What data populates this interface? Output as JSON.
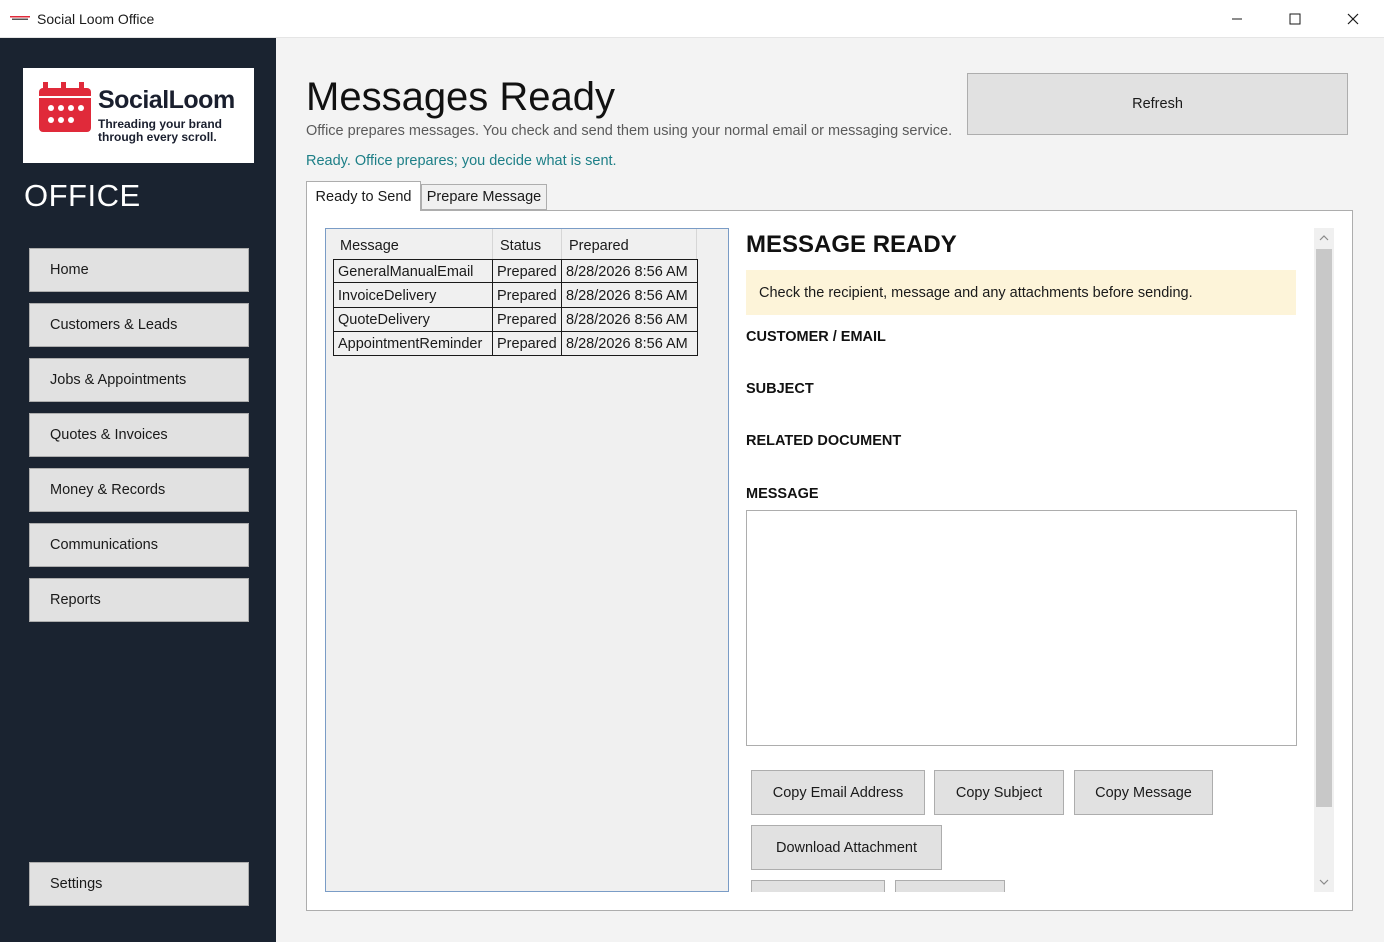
{
  "window": {
    "title": "Social Loom Office"
  },
  "sidebar": {
    "logo": {
      "name": "SocialLoom",
      "tagline": "Threading your brand through every scroll."
    },
    "section_label": "OFFICE",
    "items": [
      {
        "label": "Home"
      },
      {
        "label": "Customers & Leads"
      },
      {
        "label": "Jobs & Appointments"
      },
      {
        "label": "Quotes & Invoices"
      },
      {
        "label": "Money & Records"
      },
      {
        "label": "Communications"
      },
      {
        "label": "Reports"
      }
    ],
    "settings_label": "Settings"
  },
  "header": {
    "title": "Messages Ready",
    "subtitle": "Office prepares messages. You check and send them using your normal email or messaging service.",
    "status": "Ready. Office prepares; you decide what is sent.",
    "refresh_label": "Refresh"
  },
  "tabs": [
    {
      "label": "Ready to Send",
      "active": true
    },
    {
      "label": "Prepare Message",
      "active": false
    }
  ],
  "grid": {
    "columns": [
      "Message",
      "Status",
      "Prepared"
    ],
    "rows": [
      [
        "GeneralManualEmail",
        "Prepared",
        "8/28/2026 8:56 AM"
      ],
      [
        "InvoiceDelivery",
        "Prepared",
        "8/28/2026 8:56 AM"
      ],
      [
        "QuoteDelivery",
        "Prepared",
        "8/28/2026 8:56 AM"
      ],
      [
        "AppointmentReminder",
        "Prepared",
        "8/28/2026 8:56 AM"
      ]
    ]
  },
  "detail": {
    "title": "MESSAGE READY",
    "notice": "Check the recipient, message and any attachments before sending.",
    "labels": {
      "customer_email": "CUSTOMER / EMAIL",
      "subject": "SUBJECT",
      "related_document": "RELATED DOCUMENT",
      "message": "MESSAGE"
    },
    "message_value": "",
    "buttons": {
      "copy_email": "Copy Email Address",
      "copy_subject": "Copy Subject",
      "copy_message": "Copy Message",
      "download_attachment": "Download Attachment"
    }
  },
  "colors": {
    "sidebar_bg": "#1a2330",
    "status_text": "#1d7f87",
    "notice_bg": "#fdf4d9",
    "brand_red": "#e02a3a"
  }
}
